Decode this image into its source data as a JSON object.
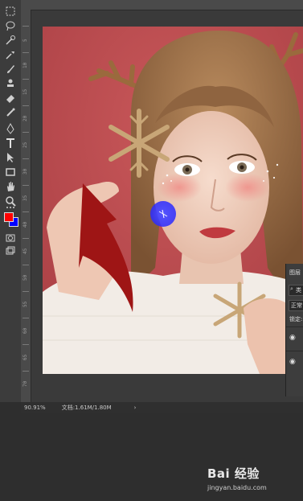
{
  "status": {
    "zoom": "90.91%",
    "doc": "文档:1.61M/1.80M"
  },
  "ruler_left_numbers": [
    "5",
    "10",
    "15",
    "20",
    "25",
    "30",
    "35",
    "40",
    "45",
    "50",
    "55",
    "60",
    "65",
    "70"
  ],
  "layers_panel": {
    "title": "图层",
    "filter": "类",
    "blend": "正常",
    "lock": "锁定:"
  },
  "watermark": {
    "brand": "Bai 经验",
    "url": "jingyan.baidu.com"
  },
  "colors": {
    "foreground": "#ff0000",
    "background": "#0000ff",
    "arrow": "#9e1515",
    "brush_cursor": "#3b3bff"
  },
  "tools": [
    "marquee-icon",
    "lasso-icon",
    "quick-select-icon",
    "eyedropper-icon",
    "brush-icon",
    "stamp-icon",
    "eraser-icon",
    "gradient-icon",
    "pen-icon",
    "type-icon",
    "path-select-icon",
    "rectangle-icon",
    "hand-icon",
    "zoom-icon",
    "more-icon"
  ]
}
